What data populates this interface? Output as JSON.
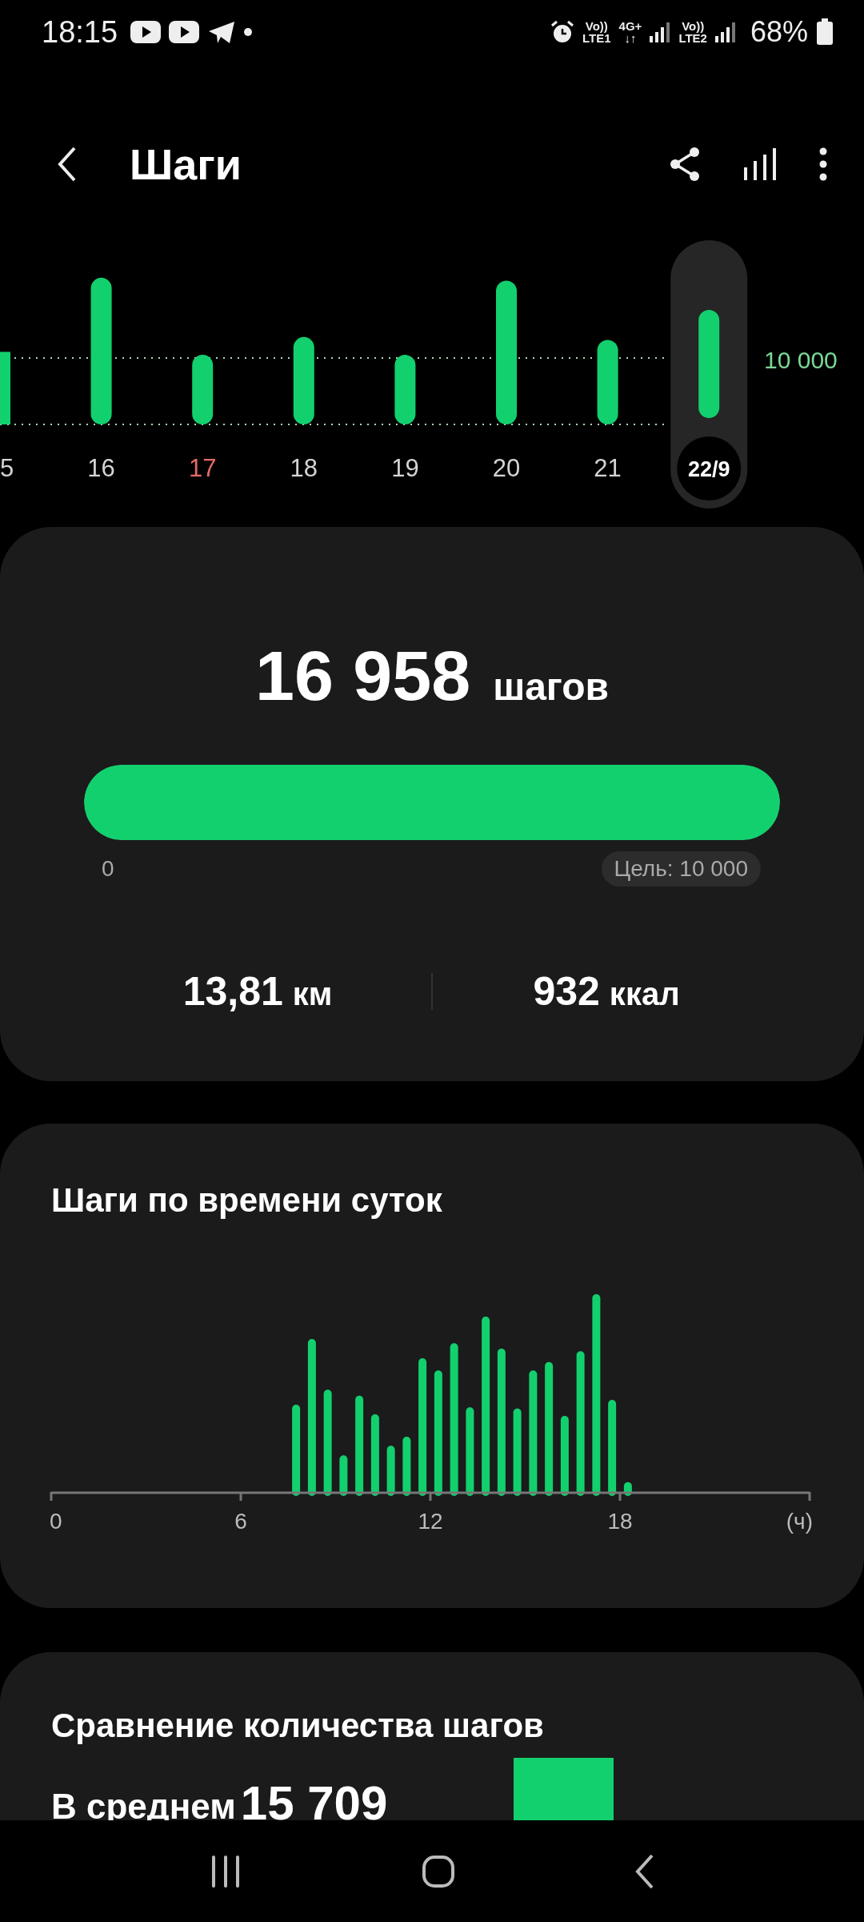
{
  "status_bar": {
    "time": "18:15",
    "network": [
      {
        "top": "Vo))",
        "bottom": "LTE1"
      },
      {
        "top": "4G+",
        "bottom": "↓↑"
      },
      {
        "top": "Vo))",
        "bottom": "LTE2"
      }
    ],
    "battery": "68%"
  },
  "header": {
    "title": "Шаги"
  },
  "days": [
    {
      "label": "5",
      "selected": false,
      "weekend": false
    },
    {
      "label": "16",
      "selected": false,
      "weekend": false
    },
    {
      "label": "17",
      "selected": false,
      "weekend": true
    },
    {
      "label": "18",
      "selected": false,
      "weekend": false
    },
    {
      "label": "19",
      "selected": false,
      "weekend": false
    },
    {
      "label": "20",
      "selected": false,
      "weekend": false
    },
    {
      "label": "21",
      "selected": false,
      "weekend": false
    },
    {
      "label": "22/9",
      "selected": true,
      "weekend": false
    }
  ],
  "goal_line": "10 000",
  "summary": {
    "steps": "16 958",
    "steps_unit": "шагов",
    "level": 1,
    "scale_start": "0",
    "goal": "Цель: 10 000",
    "distance": "13,81",
    "distance_unit": "км",
    "calories": "932",
    "calories_unit": "ккал"
  },
  "hourly": {
    "title": "Шаги по времени суток",
    "axis_labels": [
      "0",
      "6",
      "12",
      "18",
      "(ч)"
    ]
  },
  "comparison": {
    "title": "Сравнение количества шагов",
    "average_label": "В среднем",
    "average_value": "15 709"
  }
}
